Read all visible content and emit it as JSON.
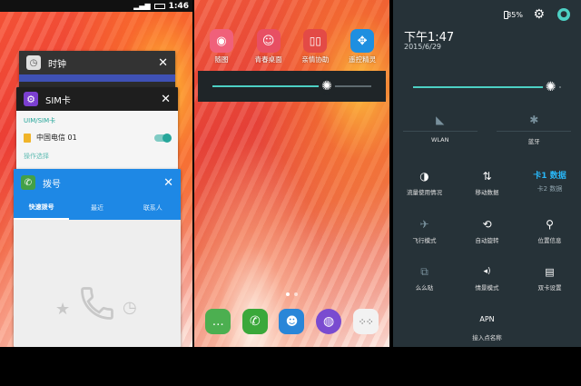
{
  "left": {
    "status_time": "1:46",
    "cards": {
      "clock": {
        "title": "时钟",
        "close": "✕"
      },
      "sim": {
        "title": "SIM卡",
        "close": "✕",
        "section": "UIM/SIM卡",
        "carrier": "中国电信 01",
        "faded": "操作选择"
      },
      "dial": {
        "title": "拨号",
        "close": "✕",
        "tabs": [
          "快速拨号",
          "最近",
          "联系人"
        ]
      }
    }
  },
  "middle": {
    "apps_top": [
      {
        "label": "随图",
        "icon": "camera-icon",
        "color": "#f0607a"
      },
      {
        "label": "青春桌面",
        "icon": "girl-icon",
        "color": "#e84f63"
      },
      {
        "label": "亲情协助",
        "icon": "phone-pair-icon",
        "color": "#e34a46"
      },
      {
        "label": "遥控精灵",
        "icon": "gamepad-icon",
        "color": "#1e8fe0"
      }
    ],
    "dock": [
      {
        "name": "messages",
        "icon": "chat-icon",
        "color": "#4caf50"
      },
      {
        "name": "phone",
        "icon": "phone-icon",
        "color": "#3aa83a"
      },
      {
        "name": "contacts",
        "icon": "contacts-icon",
        "color": "#2a86d8"
      },
      {
        "name": "browser",
        "icon": "globe-icon",
        "color": "#7a4bd0"
      },
      {
        "name": "app-drawer",
        "icon": "grid-icon",
        "color": "#f2f2f2"
      }
    ],
    "brightness_level": 0.72
  },
  "right": {
    "battery": "35%",
    "time": "下午1:47",
    "date": "2015/6/29",
    "brightness_level": 0.93,
    "row1": [
      {
        "label": "WLAN",
        "icon": "wifi-off-icon"
      },
      {
        "label": "蓝牙",
        "icon": "bluetooth-off-icon"
      }
    ],
    "row2": [
      {
        "label": "流量使用情况",
        "icon": "data-usage-icon"
      },
      {
        "label": "移动数据",
        "icon": "mobile-data-icon"
      },
      {
        "label": "卡1 数据",
        "sub": "卡2 数据",
        "icon": "sim-data-icon"
      }
    ],
    "row3": [
      {
        "label": "飞行模式",
        "icon": "airplane-icon"
      },
      {
        "label": "自动旋转",
        "icon": "rotate-icon"
      },
      {
        "label": "位置信息",
        "icon": "location-icon"
      }
    ],
    "row4": [
      {
        "label": "么么哒",
        "icon": "cast-icon"
      },
      {
        "label": "情景模式",
        "icon": "sound-profile-icon"
      },
      {
        "label": "双卡设置",
        "icon": "dual-sim-icon"
      }
    ],
    "row5": [
      {
        "label": "APN",
        "sub": "接入点名称",
        "icon": "apn-icon"
      }
    ],
    "accent": "#4dd0c4"
  }
}
